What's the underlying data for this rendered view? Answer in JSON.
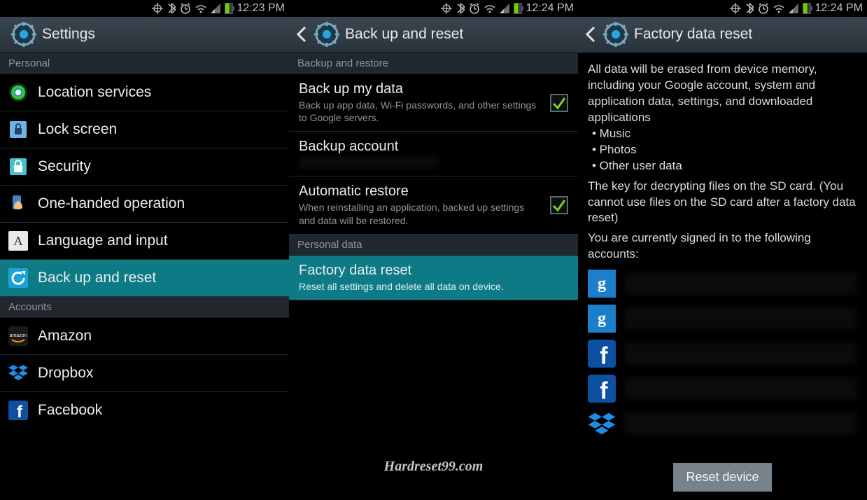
{
  "watermark": "Hardreset99.com",
  "status": {
    "time1": "12:23 PM",
    "time2": "12:24 PM",
    "time3": "12:24 PM"
  },
  "screen1": {
    "title": "Settings",
    "section_personal": "Personal",
    "items": {
      "location": "Location services",
      "lock": "Lock screen",
      "security": "Security",
      "onehand": "One-handed operation",
      "language": "Language and input",
      "backup": "Back up and reset"
    },
    "section_accounts": "Accounts",
    "accounts": {
      "amazon": "Amazon",
      "dropbox": "Dropbox",
      "facebook": "Facebook"
    }
  },
  "screen2": {
    "title": "Back up and reset",
    "section_backup": "Backup and restore",
    "backup_my_data": {
      "title": "Back up my data",
      "sub": "Back up app data, Wi-Fi passwords, and other settings to Google servers.",
      "checked": true
    },
    "backup_account": {
      "title": "Backup account"
    },
    "auto_restore": {
      "title": "Automatic restore",
      "sub": "When reinstalling an application, backed up settings and data will be restored.",
      "checked": true
    },
    "section_personal": "Personal data",
    "factory_reset": {
      "title": "Factory data reset",
      "sub": "Reset all settings and delete all data on device."
    }
  },
  "screen3": {
    "title": "Factory data reset",
    "p1": "All data will be erased from device memory, including your Google account, system and application data, settings, and downloaded applications",
    "b1": "• Music",
    "b2": "• Photos",
    "b3": "• Other user data",
    "p2": "The key for decrypting files on the SD card. (You cannot use files on the SD card after a factory data reset)",
    "p3": "You are currently signed in to the following accounts:",
    "reset_btn": "Reset device"
  }
}
